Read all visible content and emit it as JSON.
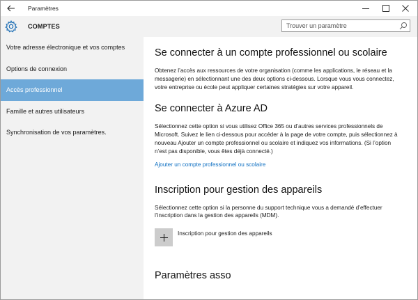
{
  "window": {
    "title": "Paramètres"
  },
  "header": {
    "section_title": "COMPTES",
    "search_placeholder": "Trouver un paramètre"
  },
  "sidebar": {
    "items": [
      {
        "label": "Votre adresse électronique et vos comptes",
        "active": false
      },
      {
        "label": "Options de connexion",
        "active": false
      },
      {
        "label": "Accès professionnel",
        "active": true
      },
      {
        "label": "Famille et autres utilisateurs",
        "active": false
      },
      {
        "label": "Synchronisation de vos paramètres.",
        "active": false
      }
    ]
  },
  "main": {
    "section1": {
      "title": "Se connecter à un compte professionnel ou scolaire",
      "body": "Obtenez l’accès aux ressources de votre organisation (comme les applications, le réseau et la messagerie) en sélectionnant une des deux options ci-dessous. Lorsque vous vous connectez, votre entreprise ou école peut appliquer certaines stratégies sur votre appareil."
    },
    "section2": {
      "title": "Se connecter à Azure AD",
      "body": "Sélectionnez cette option si vous utilisez Office 365 ou d’autres services professionnels de Microsoft. Suivez le lien ci-dessous pour accéder à la page de votre compte, puis sélectionnez à nouveau Ajouter un compte professionnel ou scolaire et indiquez vos informations. (Si l’option n’est pas disponible, vous êtes déjà connecté.)",
      "link": "Ajouter un compte professionnel ou scolaire"
    },
    "section3": {
      "title": "Inscription pour gestion des appareils",
      "body": "Sélectionnez cette option si la personne du support technique vous a demandé d’effectuer l’inscription dans la gestion des appareils (MDM).",
      "button_label": "Inscription pour gestion des appareils"
    },
    "section4": {
      "title": "Paramètres asso"
    }
  },
  "colors": {
    "accent": "#6ea9d9",
    "link": "#0d6fc2",
    "sidebar_bg": "#f2f2f2"
  }
}
